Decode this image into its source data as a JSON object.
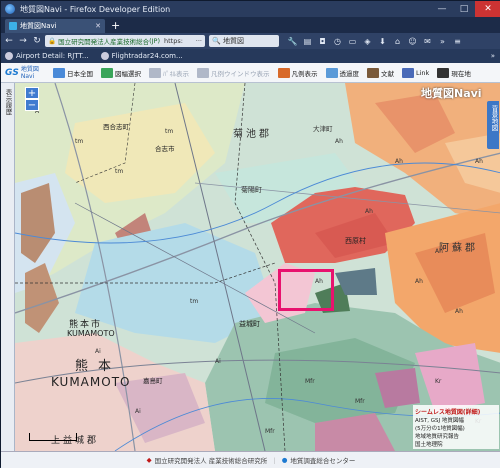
{
  "window": {
    "title": "地質図Navi - Firefox Developer Edition",
    "controls": [
      "—",
      "□",
      "✕"
    ]
  },
  "tabs": [
    {
      "label": "地質図Navi",
      "close": "✕"
    }
  ],
  "newtab_label": "+",
  "navbar": {
    "site_label": "国立研究開発法人産業技術総合",
    "site_suffix": "(JP)",
    "url_prefix": "https:",
    "more": "···",
    "search_value": "地質図"
  },
  "bookmarks": [
    {
      "label": "Airport Detail: RJTT..."
    },
    {
      "label": "Flightradar24.com..."
    }
  ],
  "bookmarks_more": "»",
  "app": {
    "logo_mark": "GS",
    "logo_text": "地質図 Navi",
    "toolbar": [
      {
        "label": "日本全国",
        "icon": "japan-icon",
        "color": "#4a8ad8",
        "enabled": true
      },
      {
        "label": "図幅選択",
        "icon": "grid-icon",
        "color": "#3aa55a",
        "enabled": true
      },
      {
        "label": "ﾊﾟﾈﾙ表示",
        "icon": "panel-icon",
        "color": "#b0b8c8",
        "enabled": false
      },
      {
        "label": "凡例ウインドウ表示",
        "icon": "legend-window-icon",
        "color": "#b0b8c8",
        "enabled": false
      },
      {
        "label": "凡例表示",
        "icon": "legend-icon",
        "color": "#d86a2a",
        "enabled": true
      },
      {
        "label": "透過度",
        "icon": "opacity-icon",
        "color": "#5a9ad8",
        "enabled": true
      },
      {
        "label": "文献",
        "icon": "book-icon",
        "color": "#7a5a3a",
        "enabled": true
      },
      {
        "label": "Link",
        "icon": "link-icon",
        "color": "#4a6ab8",
        "enabled": true
      },
      {
        "label": "現在地",
        "icon": "location-icon",
        "color": "#333333",
        "enabled": true
      }
    ]
  },
  "sidebar_left_label": "表示履歴",
  "sidebar_right_label": "背景地図",
  "watermark": "地質図Navi",
  "zoom": {
    "in": "+",
    "out": "−"
  },
  "map_labels": [
    {
      "text": "菊池郡"
    },
    {
      "text": "大津町"
    },
    {
      "text": "菊陽町"
    },
    {
      "text": "西原村"
    },
    {
      "text": "阿蘇郡"
    },
    {
      "text": "熊本市"
    },
    {
      "text": "KUMAMOTO"
    },
    {
      "text": "熊本"
    },
    {
      "text": "益城町"
    },
    {
      "text": "上益城郡"
    },
    {
      "text": "嘉島町"
    },
    {
      "text": "西合志町"
    },
    {
      "text": "合志市"
    }
  ],
  "seamless": {
    "title": "シームレス地質図(詳細)",
    "line1": "AIST, GSJ 地質図幅",
    "line2": "(5万分の1地質図幅)",
    "line3": "地域地質研究報告",
    "line4": "国土地理院"
  },
  "status": {
    "left": "国立研究開発法人 産業技術総合研究所",
    "right": "地質調査総合センター"
  },
  "colors": {
    "selection_box": "#e8126e",
    "volcanic_red": "#e0675c",
    "ash_orange": "#f3a76b",
    "plain_green": "#b8e0cc",
    "lake_blue": "#a8d4ec"
  }
}
